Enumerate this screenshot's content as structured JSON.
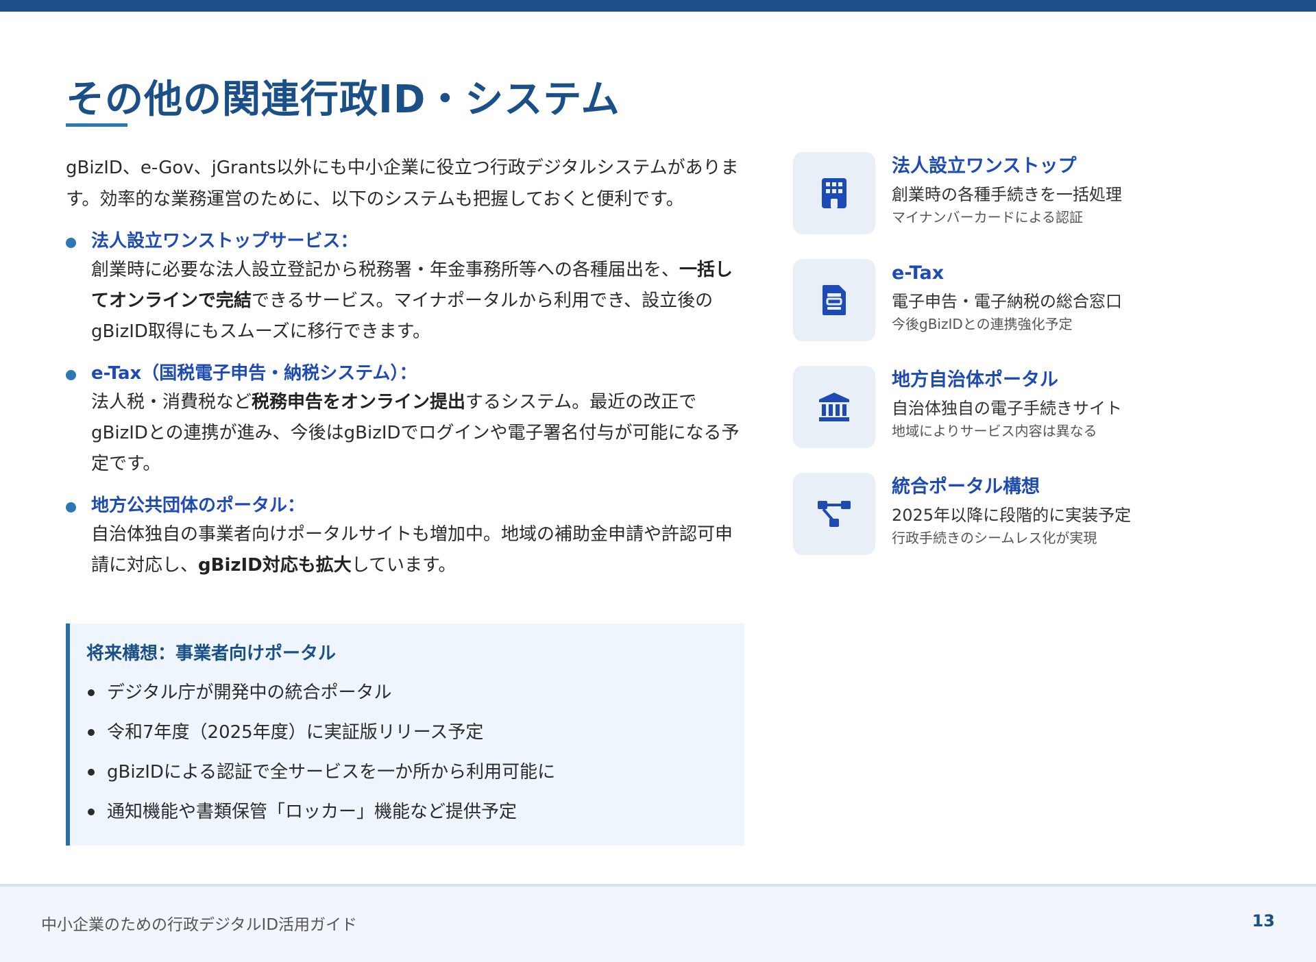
{
  "page": {
    "title": "その他の関連行政ID・システム",
    "intro": "gBizID、e-Gov、jGrants以外にも中小企業に役立つ行政デジタルシステムがあります。効率的な業務運営のために、以下のシステムも把握しておくと便利です。"
  },
  "bullets": [
    {
      "heading": "法人設立ワンストップサービス：",
      "body_before": "創業時に必要な法人設立登記から税務署・年金事務所等への各種届出を、",
      "body_bold": "一括してオンラインで完結",
      "body_after": "できるサービス。マイナポータルから利用でき、設立後のgBizID取得にもスムーズに移行できます。"
    },
    {
      "heading": "e-Tax（国税電子申告・納税システム）：",
      "body_before": "法人税・消費税など",
      "body_bold": "税務申告をオンライン提出",
      "body_after": "するシステム。最近の改正でgBizIDとの連携が進み、今後はgBizIDでログインや電子署名付与が可能になる予定です。"
    },
    {
      "heading": "地方公共団体のポータル：",
      "body_before": "自治体独自の事業者向けポータルサイトも増加中。地域の補助金申請や許認可申請に対応し、",
      "body_bold": "gBizID対応も拡大",
      "body_after": "しています。"
    }
  ],
  "future": {
    "title": "将来構想：事業者向けポータル",
    "items": [
      "デジタル庁が開発中の統合ポータル",
      "令和7年度（2025年度）に実証版リリース予定",
      "gBizIDによる認証で全サービスを一か所から利用可能に",
      "通知機能や書類保管「ロッカー」機能など提供予定"
    ]
  },
  "cards": [
    {
      "icon": "building-icon",
      "title": "法人設立ワンストップ",
      "desc": "創業時の各種手続きを一括処理",
      "sub": "マイナンバーカードによる認証"
    },
    {
      "icon": "document-icon",
      "title": "e-Tax",
      "desc": "電子申告・電子納税の総合窓口",
      "sub": "今後gBizIDとの連携強化予定"
    },
    {
      "icon": "government-building-icon",
      "title": "地方自治体ポータル",
      "desc": "自治体独自の電子手続きサイト",
      "sub": "地域によりサービス内容は異なる"
    },
    {
      "icon": "network-icon",
      "title": "統合ポータル構想",
      "desc": "2025年以降に段階的に実装予定",
      "sub": "行政手続きのシームレス化が実現"
    }
  ],
  "footer": {
    "title": "中小企業のための行政デジタルID活用ガイド",
    "page_number": "13"
  },
  "colors": {
    "primary": "#1b4f88",
    "accent": "#2a78b4",
    "heading_blue": "#1e4bb3",
    "icon_tile": "#e8eff7",
    "box_bg": "#eef5fc"
  }
}
